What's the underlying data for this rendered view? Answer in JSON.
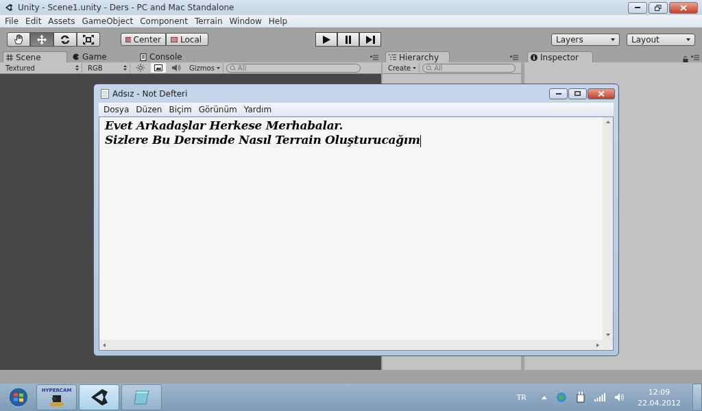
{
  "window": {
    "title": "Unity - Scene1.unity - Ders - PC and Mac Standalone"
  },
  "menu": [
    "File",
    "Edit",
    "Assets",
    "GameObject",
    "Component",
    "Terrain",
    "Window",
    "Help"
  ],
  "toolbar": {
    "tools": [
      {
        "kind": "hand",
        "selected": false
      },
      {
        "kind": "move",
        "selected": true
      },
      {
        "kind": "rotate",
        "selected": false
      },
      {
        "kind": "scale",
        "selected": false
      }
    ],
    "pivot": [
      "Center",
      "Local"
    ],
    "play": [
      {
        "kind": "play"
      },
      {
        "kind": "pause"
      },
      {
        "kind": "step"
      }
    ],
    "layers": "Layers",
    "layout": "Layout"
  },
  "scene_panel": {
    "tabs": [
      {
        "kind": "scene",
        "label": "Scene",
        "selected": true
      },
      {
        "kind": "game",
        "label": "Game",
        "selected": false
      },
      {
        "kind": "console",
        "label": "Console",
        "selected": false
      }
    ],
    "draw_mode": "Textured",
    "render_mode": "RGB",
    "toggles": [
      {
        "kind": "lighting",
        "on": false
      },
      {
        "kind": "image",
        "on": true
      },
      {
        "kind": "audio",
        "on": false
      }
    ],
    "gizmos": "Gizmos",
    "search": {
      "placeholder": "All"
    }
  },
  "hierarchy": {
    "tab": "Hierarchy",
    "create": "Create",
    "search": {
      "placeholder": "All"
    }
  },
  "inspector": {
    "tab": "Inspector"
  },
  "notepad": {
    "title": "Adsız - Not Defteri",
    "menu": [
      "Dosya",
      "Düzen",
      "Biçim",
      "Görünüm",
      "Yardım"
    ],
    "lines": [
      "Evet Arkadaşlar Herkese Merhabalar.",
      "Sizlere Bu Dersimde Nasıl Terrain Oluşturucağım"
    ]
  },
  "taskbar": {
    "apps": [
      {
        "kind": "hypercam",
        "label": "HYPERCAM",
        "selected": false
      },
      {
        "kind": "unity",
        "selected": true
      },
      {
        "kind": "notepad",
        "selected": false
      }
    ],
    "language": "TR",
    "time": "12:09",
    "date": "22.04.2012"
  }
}
